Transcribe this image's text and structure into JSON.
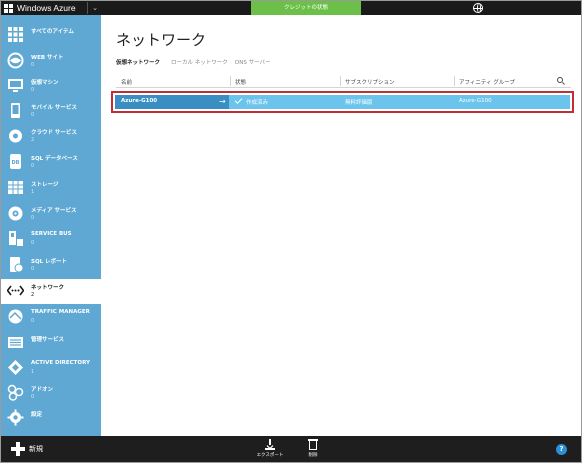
{
  "app": {
    "title": "Windows Azure"
  },
  "header": {
    "credit_label": "クレジットの状態"
  },
  "sidebar": {
    "items": [
      {
        "label": "すべてのアイテム",
        "count": ""
      },
      {
        "label": "WEB サイト",
        "count": "0"
      },
      {
        "label": "仮想マシン",
        "count": "0"
      },
      {
        "label": "モバイル サービス",
        "count": "0"
      },
      {
        "label": "クラウド サービス",
        "count": "2"
      },
      {
        "label": "SQL データベース",
        "count": "0"
      },
      {
        "label": "ストレージ",
        "count": "1"
      },
      {
        "label": "メディア サービス",
        "count": "0"
      },
      {
        "label": "SERVICE BUS",
        "count": "0"
      },
      {
        "label": "SQL レポート",
        "count": "0"
      },
      {
        "label": "ネットワーク",
        "count": "2"
      },
      {
        "label": "TRAFFIC MANAGER",
        "count": "0"
      },
      {
        "label": "管理サービス",
        "count": ""
      },
      {
        "label": "ACTIVE DIRECTORY",
        "count": "1"
      },
      {
        "label": "アドオン",
        "count": "0"
      },
      {
        "label": "設定",
        "count": ""
      }
    ]
  },
  "main": {
    "title": "ネットワーク",
    "tabs": [
      {
        "label": "仮想ネットワーク"
      },
      {
        "label": "ローカル ネットワーク"
      },
      {
        "label": "DNS サーバー"
      }
    ],
    "columns": [
      "名前",
      "状態",
      "サブスクリプション",
      "アフィニティ グループ"
    ],
    "rows": [
      {
        "name": "Azure-G100",
        "status": "作成済み",
        "subscription": "無料評価版",
        "affinity_group": "Azure-G100"
      }
    ]
  },
  "bottombar": {
    "new_label": "新規",
    "export_label": "エクスポート",
    "delete_label": "削除",
    "help_label": "?"
  },
  "colors": {
    "sidebar_bg": "#5fa8d3",
    "selected_row": "#6bc4ec",
    "highlight_border": "#c22e36",
    "credit_green": "#6cc04a"
  }
}
